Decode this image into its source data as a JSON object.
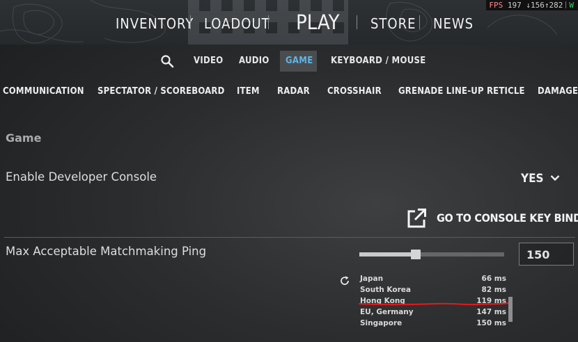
{
  "nav": {
    "items": [
      "INVENTORY",
      "LOADOUT",
      "PLAY",
      "STORE",
      "NEWS"
    ]
  },
  "fps": {
    "label": "FPS",
    "value": "197",
    "low": "↓156",
    "high": "↑282",
    "indicator": "W"
  },
  "subnav": {
    "items": [
      "VIDEO",
      "AUDIO",
      "GAME",
      "KEYBOARD / MOUSE"
    ],
    "active": "GAME"
  },
  "tabs": [
    "COMMUNICATION",
    "SPECTATOR / SCOREBOARD",
    "ITEM",
    "RADAR",
    "CROSSHAIR",
    "GRENADE LINE-UP RETICLE",
    "DAMAGE"
  ],
  "section": {
    "title": "Game"
  },
  "settings": {
    "dev_console": {
      "label": "Enable Developer Console",
      "value": "YES"
    },
    "console_link": {
      "label": "GO TO CONSOLE KEY BINDING"
    },
    "max_ping": {
      "label": "Max Acceptable Matchmaking Ping",
      "value": "150",
      "slider_fraction": 0.39
    }
  },
  "regions": [
    {
      "name": "Japan",
      "ping": "66 ms"
    },
    {
      "name": "South Korea",
      "ping": "82 ms"
    },
    {
      "name": "Hong Kong",
      "ping": "119 ms"
    },
    {
      "name": "EU, Germany",
      "ping": "147 ms"
    },
    {
      "name": "Singapore",
      "ping": "150 ms"
    }
  ],
  "colors": {
    "accent": "#5fb3e6",
    "annotation": "#e0191b"
  }
}
